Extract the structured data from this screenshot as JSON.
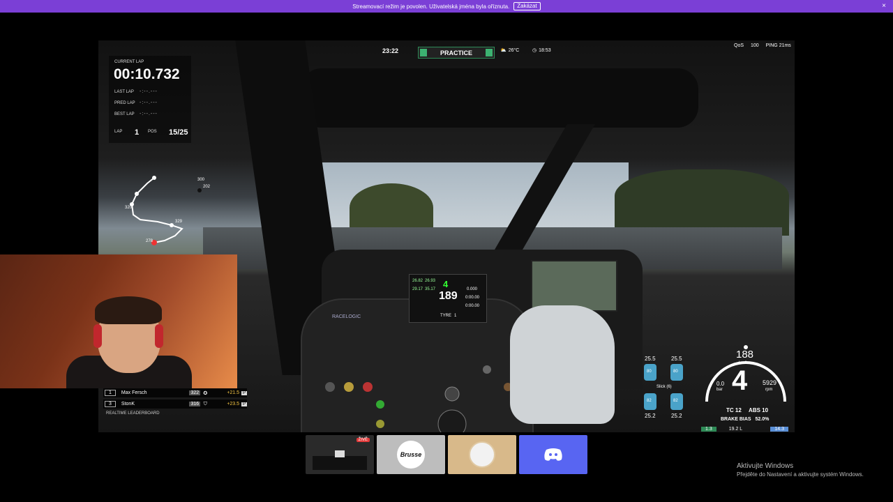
{
  "notification": {
    "message": "Streamovací režim je povolen. Uživatelská jména byla oříznuta.",
    "disable_button": "Zakázat",
    "close_symbol": "×"
  },
  "hud": {
    "current_lap_label": "CURRENT LAP",
    "current_lap_time": "00:10.732",
    "last_lap_label": "LAST LAP",
    "pred_lap_label": "PRED LAP",
    "best_lap_label": "BEST LAP",
    "placeholder_time": "-:--.---",
    "lap_label": "LAP",
    "lap_value": "1",
    "pos_label": "POS",
    "pos_value": "15/25",
    "session_clock": "23:22",
    "session_type": "PRACTICE",
    "temperature": "26°C",
    "time_of_day": "18:53",
    "qos_label": "QoS",
    "qos_value": "100",
    "ping_label": "PING",
    "ping_value": "21ms"
  },
  "map_labels": [
    "300",
    "202",
    "320",
    "329",
    "278"
  ],
  "dash_display": {
    "gear": "4",
    "speed": "189",
    "split1": "26.82",
    "split2": "26.93",
    "split3": "29.17",
    "split4": "35.17",
    "tyre_label": "TYRE",
    "tyre_value": "1",
    "value_a": "0.000",
    "value_b": "0:00.00",
    "value_c": "0:00.00",
    "brand": "RACELOGIC"
  },
  "telemetry": {
    "speed": "188",
    "speed_unit": "km/h",
    "gear": "4",
    "rpm": "5929",
    "rpm_unit": "rpm",
    "boost": "0.0",
    "boost_unit": "bar",
    "tc_label": "TC",
    "tc_value": "12",
    "abs_label": "ABS",
    "abs_value": "10",
    "brake_bias_label": "BRAKE BIAS",
    "brake_bias_value": "52.0%",
    "fuel_left": "1.3",
    "fuel_total": "19.2 L",
    "fuel_right": "14.3",
    "tyre_fl": "25.5",
    "tyre_fr": "25.5",
    "tyre_rl": "25.2",
    "tyre_rr": "25.2",
    "tyre_compound": "Slick (6)",
    "tyre_fl_inner": "80",
    "tyre_fr_inner": "80",
    "tyre_rl_inner": "82",
    "tyre_rr_inner": "82"
  },
  "leaderboard": {
    "rows": [
      {
        "pos": "1",
        "name": "Max Fersch",
        "number": "322",
        "gap": "+21.5",
        "flag": "P"
      },
      {
        "pos": "3",
        "name": "StonK",
        "number": "316",
        "gap": "+23.5",
        "flag": "P"
      }
    ],
    "footer": "REALTIME LEADERBOARD"
  },
  "thumbnails": {
    "live_badge": "ŽIVĚ",
    "brand_text": "Brusse"
  },
  "windows_activation": {
    "title": "Aktivujte Windows",
    "subtitle": "Přejděte do Nastavení a aktivujte systém Windows."
  }
}
